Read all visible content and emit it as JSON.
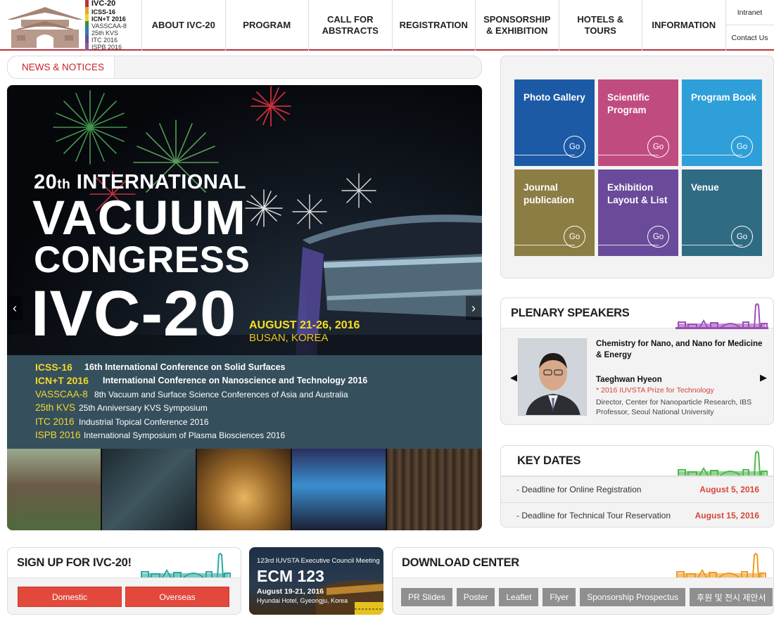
{
  "logo": {
    "lines": [
      "IVC-20",
      "ICSS-16",
      "ICN+T 2016",
      "VASSCAA-8",
      "25th KVS",
      "ITC 2016",
      "ISPB 2016"
    ]
  },
  "nav": {
    "items": [
      "ABOUT IVC-20",
      "PROGRAM",
      "CALL FOR ABSTRACTS",
      "REGISTRATION",
      "SPONSORSHIP & EXHIBITION",
      "HOTELS & TOURS",
      "INFORMATION"
    ],
    "intranet": "Intranet",
    "contact": "Contact Us"
  },
  "news": {
    "tab": "NEWS & NOTICES"
  },
  "banner": {
    "line1_num": "20",
    "line1_sup": "th",
    "line1_rest": " INTERNATIONAL",
    "line2": "VACUUM",
    "line3": "CONGRESS",
    "line4": "IVC-20",
    "date": "AUGUST 21-26, 2016",
    "place": "BUSAN, KOREA",
    "prev": "‹",
    "next": "›",
    "conferences": [
      {
        "abbr": "ICSS-16",
        "name": "16th International Conference on Solid Surfaces",
        "strong": true
      },
      {
        "abbr": "ICN+T 2016",
        "name": "International Conference on Nanoscience and Technology 2016",
        "strong": true
      },
      {
        "abbr": "VASSCAA-8",
        "name": "8th Vacuum and Surface Science Conferences of Asia and Australia",
        "strong": false
      },
      {
        "abbr": "25th KVS",
        "name": "25th Anniversary KVS  Symposium",
        "strong": false
      },
      {
        "abbr": "ITC 2016",
        "name": "Industrial Topical Conference 2016",
        "strong": false
      },
      {
        "abbr": "ISPB 2016",
        "name": "International Symposium of Plasma Biosciences 2016",
        "strong": false
      }
    ]
  },
  "tiles": [
    {
      "label": "Photo Gallery",
      "go": "Go",
      "color": "#1d5aa6"
    },
    {
      "label": "Scientific Program",
      "go": "Go",
      "color": "#c04b7f"
    },
    {
      "label": "Program Book",
      "go": "Go",
      "color": "#2e9fd8"
    },
    {
      "label": "Journal publication",
      "go": "Go",
      "color": "#8c7d45"
    },
    {
      "label": "Exhibition Layout & List",
      "go": "Go",
      "color": "#6a4a9a"
    },
    {
      "label": "Venue",
      "go": "Go",
      "color": "#2f6b82"
    }
  ],
  "plenary": {
    "title": "PLENARY SPEAKERS",
    "topic": "Chemistry for Nano, and Nano for Medicine & Energy",
    "name": "Taeghwan Hyeon",
    "prize": "* 2016 IUVSTA Prize for Technology",
    "affiliation": "Director, Center for Nanoparticle Research, IBS Professor, Seoul National University",
    "prev": "◀",
    "next": "▶"
  },
  "keydates": {
    "title": "KEY DATES",
    "rows": [
      {
        "label": "- Deadline for Online Registration",
        "date": "August 5, 2016"
      },
      {
        "label": "- Deadline for Technical Tour Reservation",
        "date": "August 15, 2016"
      }
    ]
  },
  "signup": {
    "title": "SIGN UP FOR IVC-20!",
    "domestic": "Domestic",
    "overseas": "Overseas"
  },
  "ecm": {
    "subtitle": "123rd IUVSTA Executive Council Meeting",
    "title": "ECM 123",
    "date": "August 19-21, 2016",
    "venue": "Hyundai Hotel, Gyeongju, Korea"
  },
  "download": {
    "title": "DOWNLOAD CENTER",
    "buttons": [
      "PR Slides",
      "Poster",
      "Leaflet",
      "Flyer",
      "Sponsorship Prospectus",
      "후원 및 전시 제안서"
    ]
  },
  "colors": {
    "brand_red": "#b9343a",
    "accent_red": "#e2493c",
    "banner_yellow": "#f1d92d",
    "conf_panel": "#354f5c",
    "skyline_purple": "#9b4fb5",
    "skyline_green": "#4cb84c",
    "skyline_teal": "#2aa7a0",
    "skyline_orange": "#f09a1e"
  }
}
